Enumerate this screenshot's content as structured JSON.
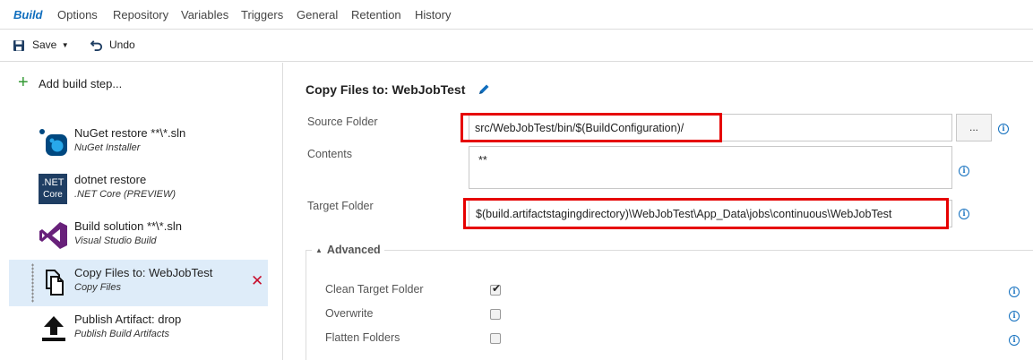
{
  "tabs": [
    "Build",
    "Options",
    "Repository",
    "Variables",
    "Triggers",
    "General",
    "Retention",
    "History"
  ],
  "toolbar": {
    "save_label": "Save",
    "undo_label": "Undo"
  },
  "left": {
    "add_step_label": "Add build step...",
    "steps": [
      {
        "title": "NuGet restore **\\*.sln",
        "subtitle": "NuGet Installer",
        "icon": "nuget-icon"
      },
      {
        "title": "dotnet restore",
        "subtitle": ".NET Core (PREVIEW)",
        "icon": "dotnet-core-icon",
        "icon_text_1": ".NET",
        "icon_text_2": "Core"
      },
      {
        "title": "Build solution **\\*.sln",
        "subtitle": "Visual Studio Build",
        "icon": "visual-studio-icon"
      },
      {
        "title": "Copy Files to: WebJobTest",
        "subtitle": "Copy Files",
        "icon": "copy-files-icon",
        "selected": true
      },
      {
        "title": "Publish Artifact: drop",
        "subtitle": "Publish Build Artifacts",
        "icon": "publish-artifact-icon"
      }
    ]
  },
  "task": {
    "title": "Copy Files to: WebJobTest",
    "source_folder": {
      "label": "Source Folder",
      "value": "src/WebJobTest/bin/$(BuildConfiguration)/",
      "browse_label": "..."
    },
    "contents": {
      "label": "Contents",
      "value": "**"
    },
    "target_folder": {
      "label": "Target Folder",
      "value": "$(build.artifactstagingdirectory)\\WebJobTest\\App_Data\\jobs\\continuous\\WebJobTest"
    },
    "advanced": {
      "label": "Advanced",
      "options": [
        {
          "label": "Clean Target Folder",
          "checked": true
        },
        {
          "label": "Overwrite",
          "checked": false
        },
        {
          "label": "Flatten Folders",
          "checked": false
        }
      ]
    }
  },
  "colors": {
    "accent": "#106ebe",
    "highlight_border": "#e60000",
    "selected_row": "#deecf9",
    "delete": "#c8102e",
    "add": "#339933"
  }
}
